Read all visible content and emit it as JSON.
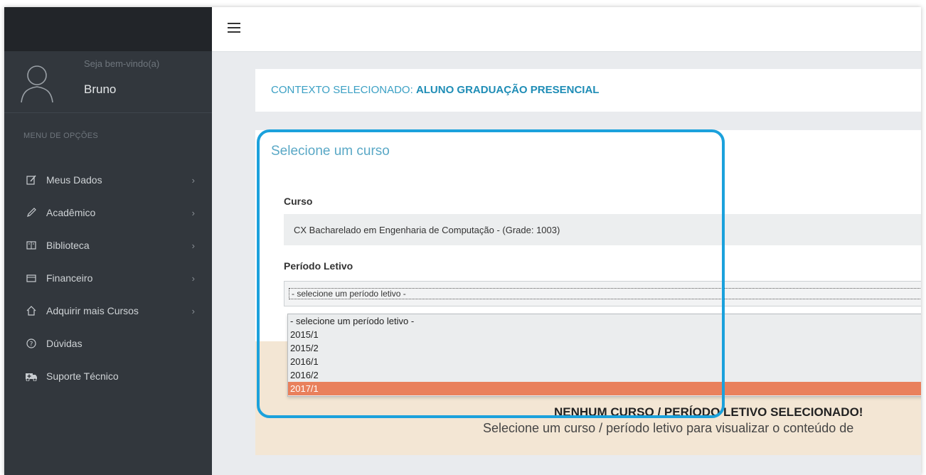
{
  "sidebar": {
    "welcome": "Seja bem-vindo(a)",
    "username": "Bruno",
    "menu_heading": "MENU DE OPÇÕES",
    "items": [
      {
        "label": "Meus Dados",
        "icon": "edit-icon",
        "chevron": "›"
      },
      {
        "label": "Acadêmico",
        "icon": "pencil-icon",
        "chevron": "›"
      },
      {
        "label": "Biblioteca",
        "icon": "book-icon",
        "chevron": "›"
      },
      {
        "label": "Financeiro",
        "icon": "wallet-icon",
        "chevron": "›"
      },
      {
        "label": "Adquirir mais Cursos",
        "icon": "home-icon",
        "chevron": "›"
      },
      {
        "label": "Dúvidas",
        "icon": "help-icon"
      },
      {
        "label": "Suporte Técnico",
        "icon": "ambulance-icon"
      }
    ]
  },
  "context": {
    "prefix": "CONTEXTO SELECIONADO:",
    "value": "ALUNO GRADUAÇÃO PRESENCIAL"
  },
  "course_panel": {
    "title": "Selecione um curso",
    "curso_label": "Curso",
    "curso_value": "CX Bacharelado em Engenharia de Computação - (Grade: 1003)",
    "periodo_label": "Período Letivo",
    "periodo_selected": "- selecione um período letivo -",
    "periodo_options": [
      "- selecione um período letivo -",
      "2015/1",
      "2015/2",
      "2016/1",
      "2016/2",
      "2017/1"
    ],
    "highlighted_option": "2017/1"
  },
  "message": {
    "title": "NENHUM CURSO / PERÍODO LETIVO SELECIONADO!",
    "body": "Selecione um curso / período letivo para visualizar o conteúdo de"
  },
  "colors": {
    "sidebar_bg": "#32373d",
    "accent_blue": "#1ba1dc",
    "option_highlight": "#e9805c",
    "message_bg": "#f3e6d4"
  }
}
